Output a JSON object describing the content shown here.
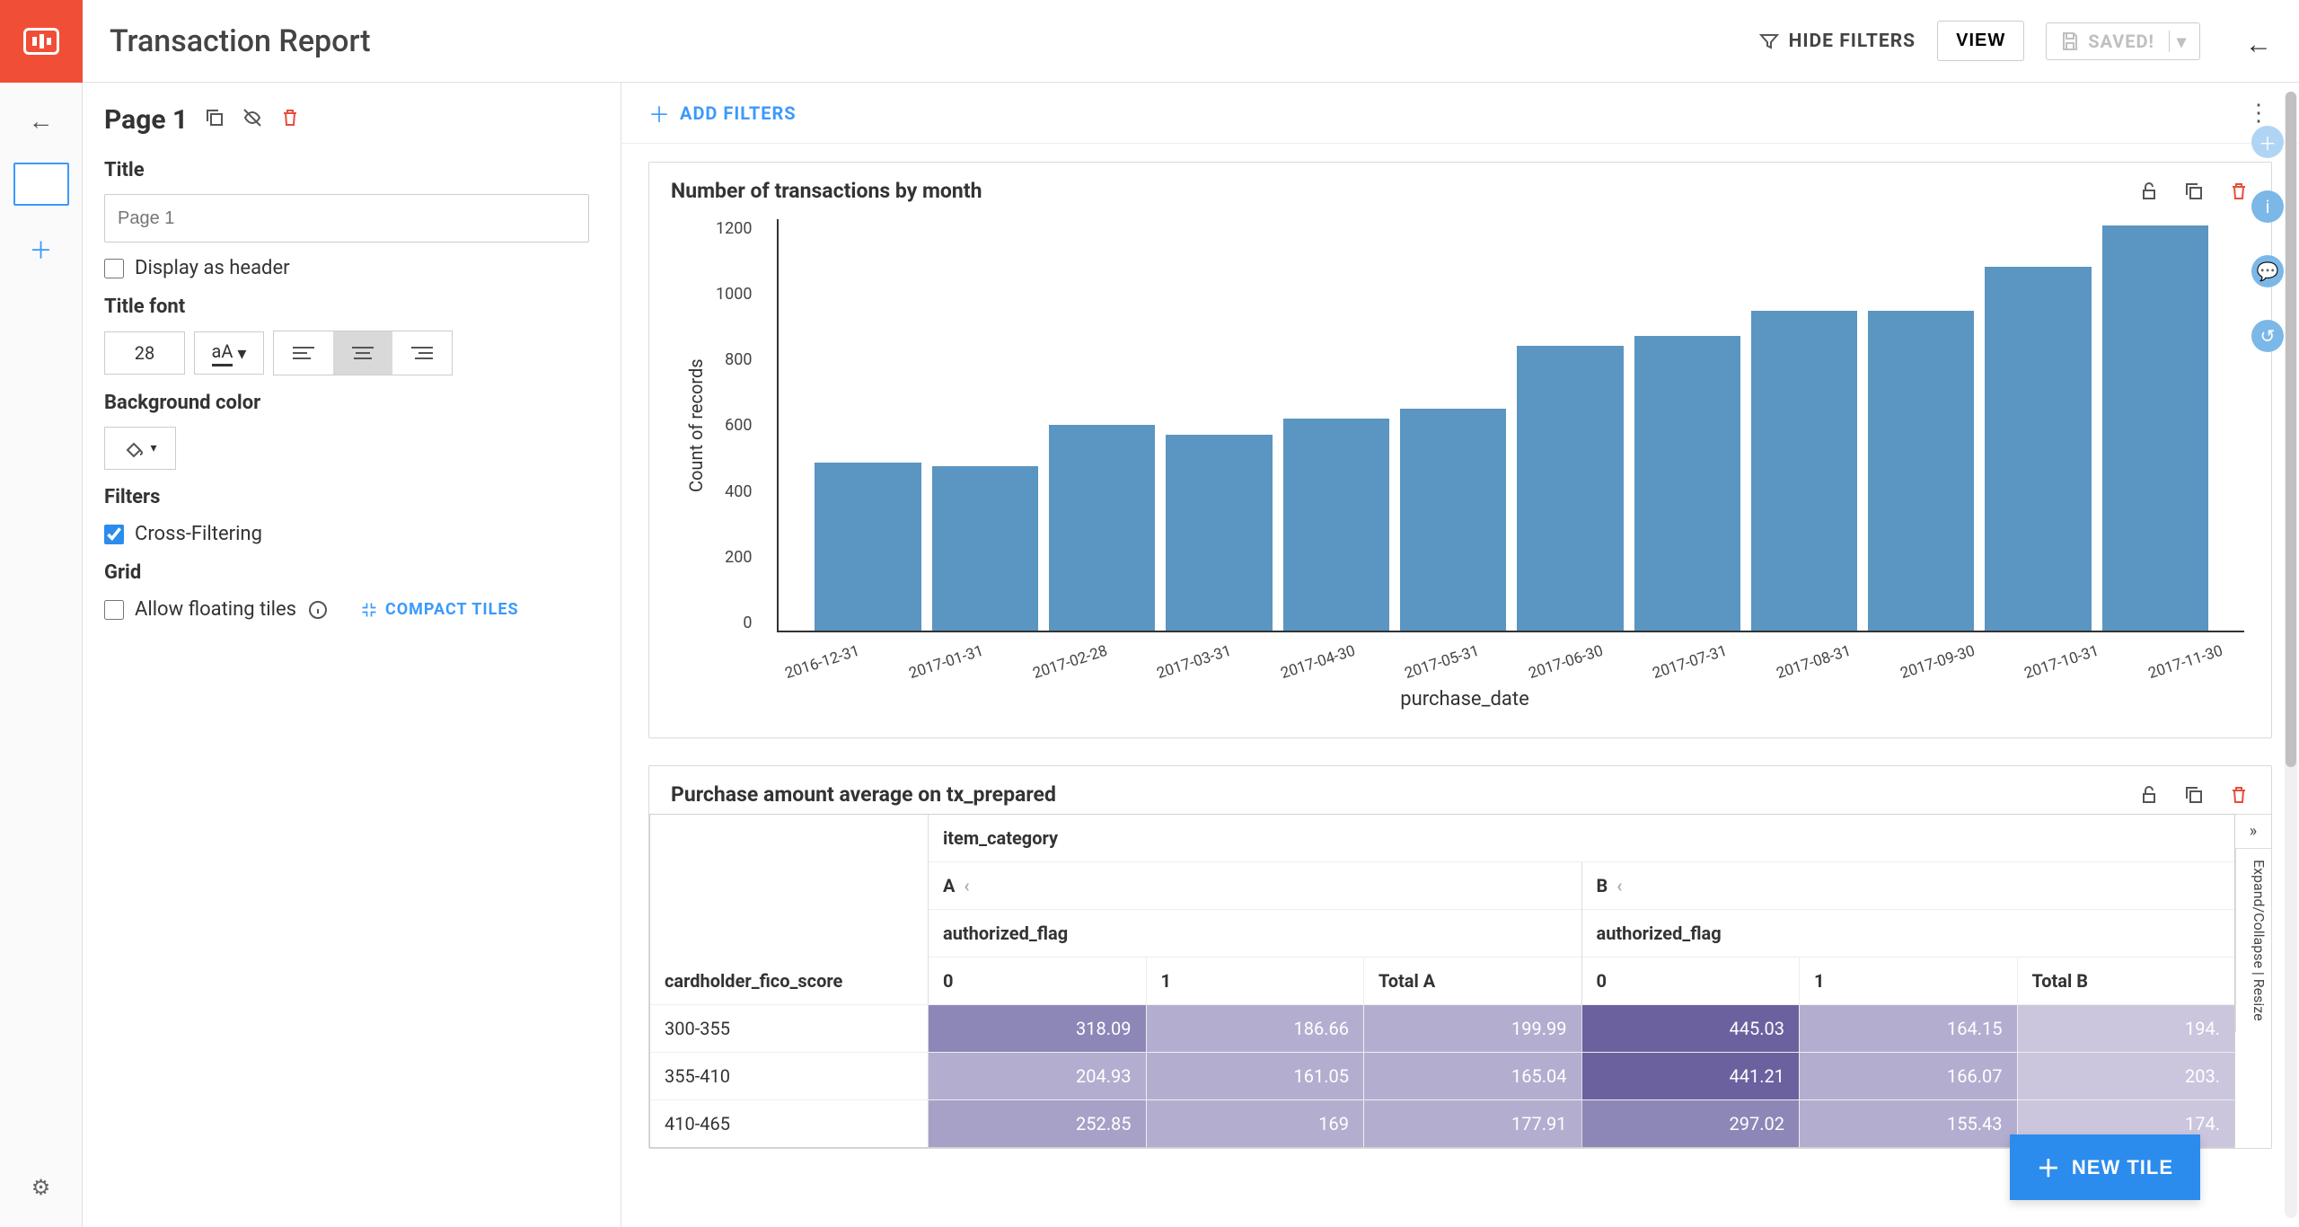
{
  "topbar": {
    "title": "Transaction Report",
    "hide_filters": "HIDE FILTERS",
    "view": "VIEW",
    "saved": "SAVED!"
  },
  "page_header": {
    "title": "Page 1"
  },
  "sidebar": {
    "title_section": "Title",
    "title_placeholder": "Page 1",
    "display_as_header": "Display as header",
    "title_font_section": "Title font",
    "font_size": "28",
    "font_style_sample": "aA",
    "bg_section": "Background color",
    "filters_section": "Filters",
    "cross_filtering": "Cross-Filtering",
    "grid_section": "Grid",
    "allow_floating": "Allow floating tiles",
    "compact_tiles": "COMPACT TILES"
  },
  "filter_bar": {
    "add_filters": "ADD FILTERS"
  },
  "tile_chart": {
    "title": "Number of transactions by month"
  },
  "tile_pivot": {
    "title": "Purchase amount average on tx_prepared",
    "category_header": "item_category",
    "groups": [
      "A",
      "B"
    ],
    "subheader": "authorized_flag",
    "row_header": "cardholder_fico_score",
    "collapse_label": "Expand/Collapse | Resize",
    "columns": [
      "0",
      "1",
      "Total A"
    ],
    "columnsB": [
      "0",
      "1",
      "Total B"
    ],
    "rows": [
      {
        "label": "300-355",
        "a0": "318.09",
        "a1": "186.66",
        "ta": "199.99",
        "b0": "445.03",
        "b1": "164.15",
        "tb": "194."
      },
      {
        "label": "355-410",
        "a0": "204.93",
        "a1": "161.05",
        "ta": "165.04",
        "b0": "441.21",
        "b1": "166.07",
        "tb": "203."
      },
      {
        "label": "410-465",
        "a0": "252.85",
        "a1": "169",
        "ta": "177.91",
        "b0": "297.02",
        "b1": "155.43",
        "tb": "174."
      }
    ]
  },
  "new_tile": "NEW TILE",
  "chart_data": {
    "type": "bar",
    "title": "Number of transactions by month",
    "xlabel": "purchase_date",
    "ylabel": "Count of records",
    "ylim": [
      0,
      1300
    ],
    "yticks": [
      0,
      200,
      400,
      600,
      800,
      1000,
      1200
    ],
    "categories": [
      "2016-12-31",
      "2017-01-31",
      "2017-02-28",
      "2017-03-31",
      "2017-04-30",
      "2017-05-31",
      "2017-06-30",
      "2017-07-31",
      "2017-08-31",
      "2017-09-30",
      "2017-10-31",
      "2017-11-30"
    ],
    "values": [
      530,
      520,
      650,
      620,
      670,
      700,
      900,
      930,
      1010,
      1010,
      1150,
      1280
    ]
  }
}
